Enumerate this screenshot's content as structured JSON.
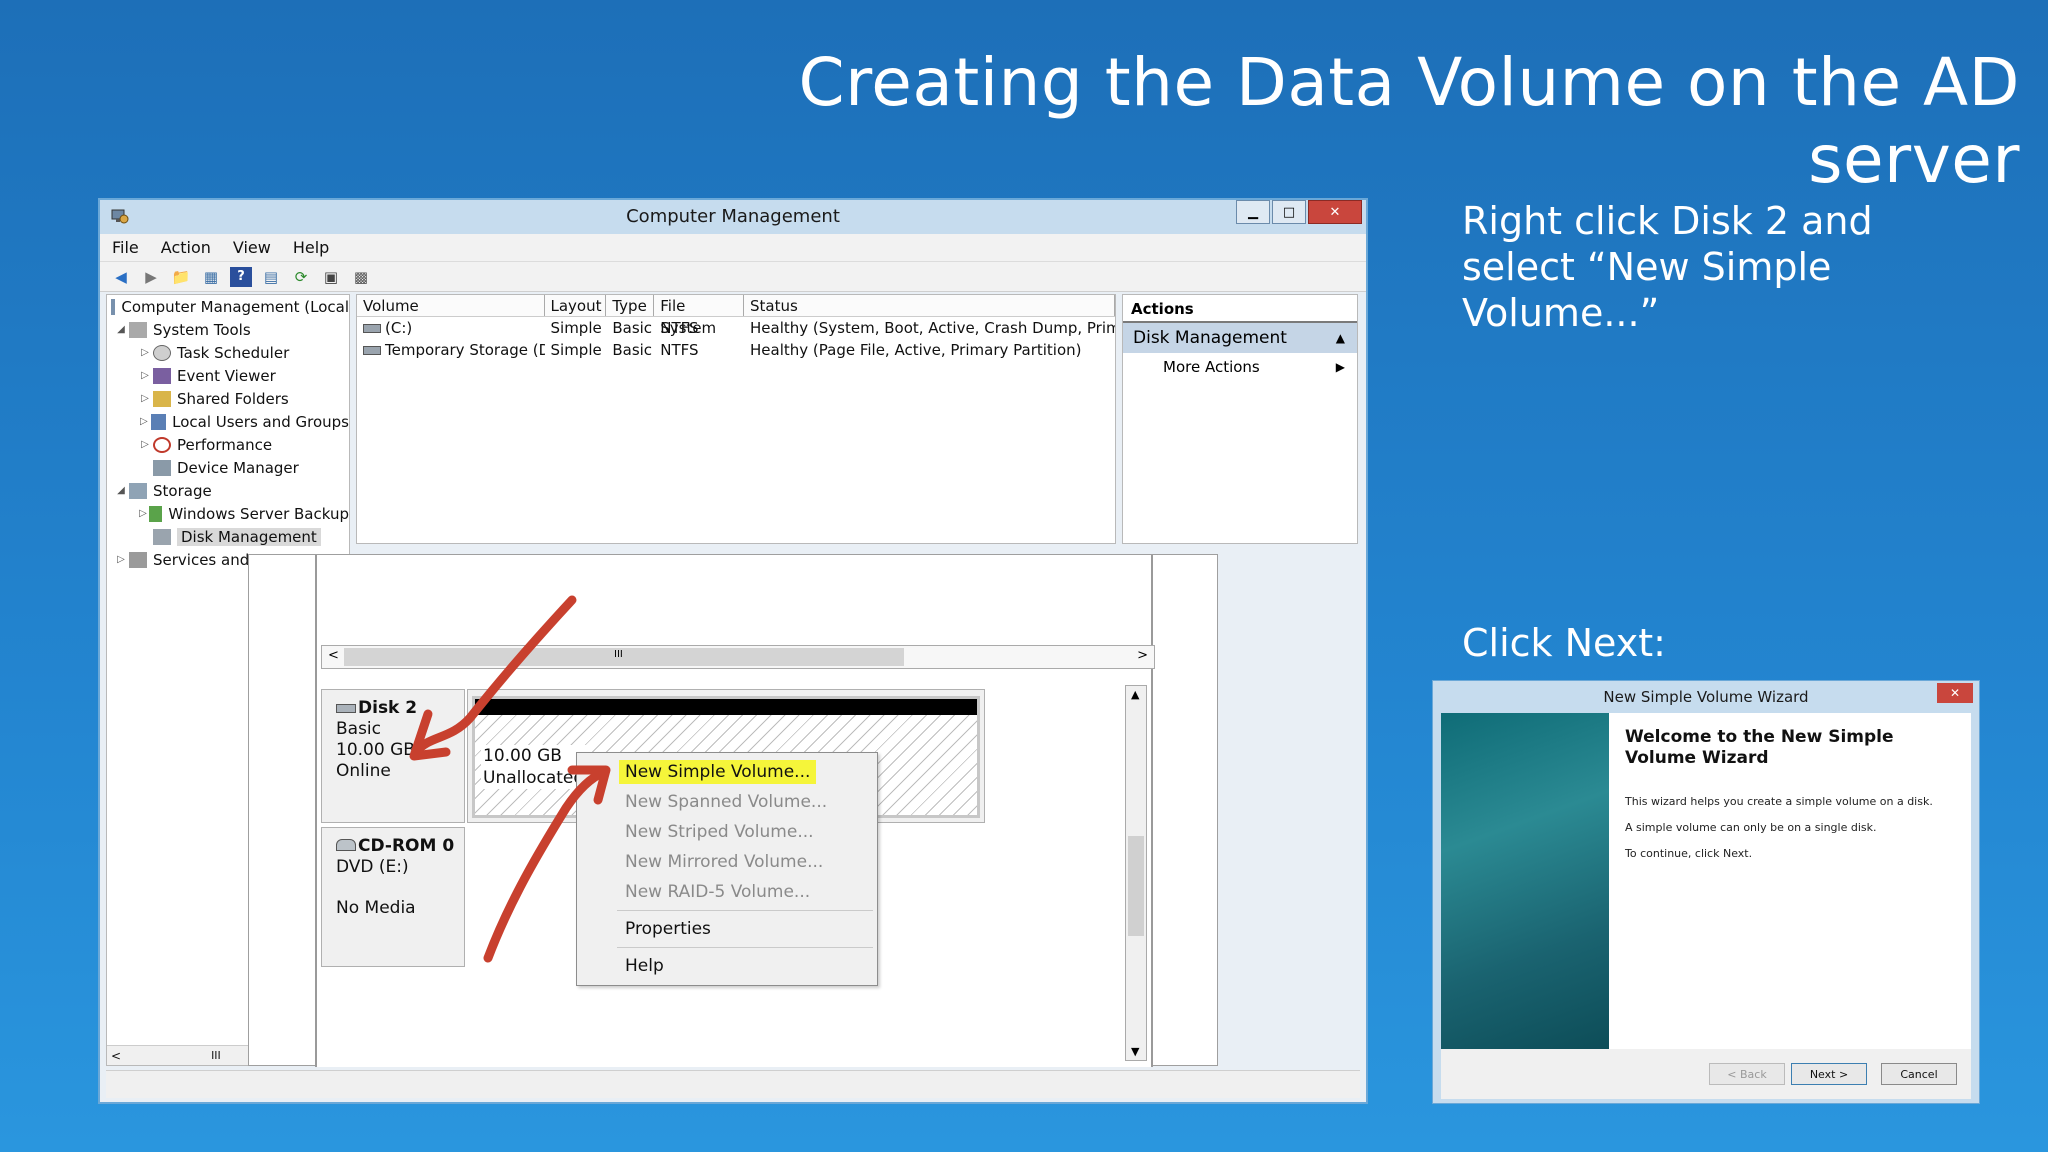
{
  "slide": {
    "title": "Creating the Data Volume on the AD server",
    "note1": "Right click Disk 2 and select “New Simple Volume...”",
    "note2": "Click Next:"
  },
  "computer_management": {
    "title": "Computer Management",
    "menu": [
      "File",
      "Action",
      "View",
      "Help"
    ],
    "tree": [
      {
        "label": "Computer Management (Local",
        "icon": "computer-management-icon"
      },
      {
        "label": "System Tools",
        "icon": "tools-icon"
      },
      {
        "label": "Task Scheduler",
        "icon": "clock-icon"
      },
      {
        "label": "Event Viewer",
        "icon": "event-viewer-icon"
      },
      {
        "label": "Shared Folders",
        "icon": "shared-folder-icon"
      },
      {
        "label": "Local Users and Groups",
        "icon": "users-icon"
      },
      {
        "label": "Performance",
        "icon": "performance-icon"
      },
      {
        "label": "Device Manager",
        "icon": "device-manager-icon"
      },
      {
        "label": "Storage",
        "icon": "storage-icon"
      },
      {
        "label": "Windows Server Backup",
        "icon": "backup-icon"
      },
      {
        "label": "Disk Management",
        "icon": "disk-icon"
      },
      {
        "label": "Services and",
        "icon": "services-icon"
      }
    ],
    "volume_table": {
      "headers": [
        "Volume",
        "Layout",
        "Type",
        "File System",
        "Status"
      ],
      "rows": [
        [
          "(C:)",
          "Simple",
          "Basic",
          "NTFS",
          "Healthy (System, Boot, Active, Crash Dump, Primary P"
        ],
        [
          "Temporary Storage (D:)",
          "Simple",
          "Basic",
          "NTFS",
          "Healthy (Page File, Active, Primary Partition)"
        ]
      ]
    },
    "actions": {
      "header": "Actions",
      "selected": "Disk Management",
      "more": "More Actions"
    },
    "disks": {
      "disk2": {
        "name": "Disk 2",
        "type": "Basic",
        "size": "10.00 GB",
        "state": "Online"
      },
      "partition": {
        "size": "10.00 GB",
        "label": "Unallocated"
      },
      "cdrom": {
        "name": "CD-ROM 0",
        "drive": "DVD (E:)",
        "media": "No Media"
      }
    },
    "context_menu": [
      "New Simple Volume...",
      "New Spanned Volume...",
      "New Striped Volume...",
      "New Mirrored Volume...",
      "New RAID-5 Volume...",
      "Properties",
      "Help"
    ]
  },
  "wizard": {
    "title": "New Simple Volume Wizard",
    "heading": "Welcome to the New Simple Volume Wizard",
    "text1": "This wizard helps you create a simple volume on a disk.",
    "text2": "A simple volume can only be on a single disk.",
    "text3": "To continue, click Next.",
    "back": "< Back",
    "next": "Next >",
    "cancel": "Cancel"
  },
  "colors": {
    "background": "#1d6fb8",
    "highlight": "#f5f53a",
    "annotation_arrow": "#c8402e"
  }
}
